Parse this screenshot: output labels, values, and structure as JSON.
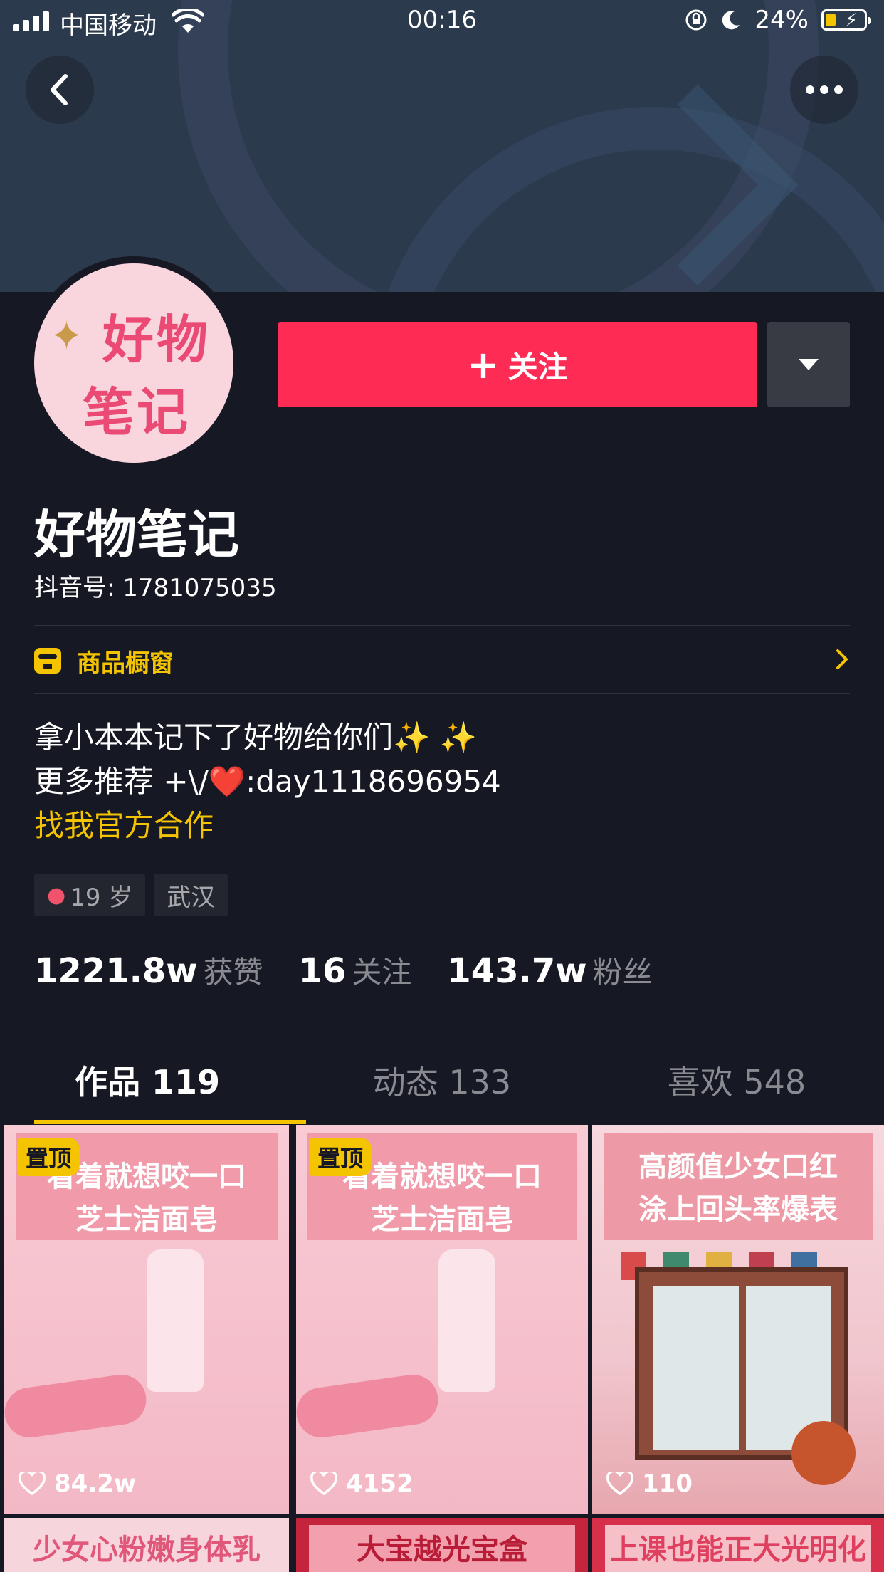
{
  "status_bar": {
    "carrier": "中国移动",
    "time": "00:16",
    "battery_percent": "24%",
    "icons": [
      "signal-icon",
      "wifi-icon",
      "rotation-lock-icon",
      "moon-icon",
      "battery-icon"
    ]
  },
  "header": {
    "back_icon": "chevron-left-icon",
    "more_icon": "more-dots-icon"
  },
  "profile": {
    "avatar_text_line1": "好物",
    "avatar_text_line2": "笔记",
    "name": "好物笔记",
    "douyin_id": "抖音号: 1781075035",
    "follow_label": "关注",
    "follow_icon": "plus-icon",
    "dropdown_icon": "triangle-down-icon"
  },
  "shop": {
    "label": "商品橱窗",
    "icon": "shop-icon"
  },
  "bio": {
    "line1": "拿小本本记下了好物给你们✨ ✨",
    "line2": "更多推荐 +\\/❤️:day1118696954",
    "cooperation": "找我官方合作"
  },
  "tags": {
    "age": "19 岁",
    "city": "武汉"
  },
  "stats": [
    {
      "num": "1221.8w",
      "label": "获赞"
    },
    {
      "num": "16",
      "label": "关注"
    },
    {
      "num": "143.7w",
      "label": "粉丝"
    }
  ],
  "tabs": [
    {
      "label": "作品 119",
      "active": true
    },
    {
      "label": "动态 133",
      "active": false
    },
    {
      "label": "喜欢 548",
      "active": false
    }
  ],
  "videos": [
    {
      "cap1": "看着就想咬一口",
      "cap2": "芝士洁面皂",
      "pinned": "置顶",
      "likes": "84.2w"
    },
    {
      "cap1": "看着就想咬一口",
      "cap2": "芝士洁面皂",
      "pinned": "置顶",
      "likes": "4152"
    },
    {
      "cap1": "高颜值少女口红",
      "cap2": "涂上回头率爆表",
      "likes": "110"
    },
    {
      "cap1": "少女心粉嫩身体乳"
    },
    {
      "cap1": "大宝越光宝盒"
    },
    {
      "cap1": "上课也能正大光明化妆"
    }
  ],
  "colors": {
    "background": "#161823",
    "follow_red": "#fe2c55",
    "accent_yellow": "#f5c400"
  }
}
